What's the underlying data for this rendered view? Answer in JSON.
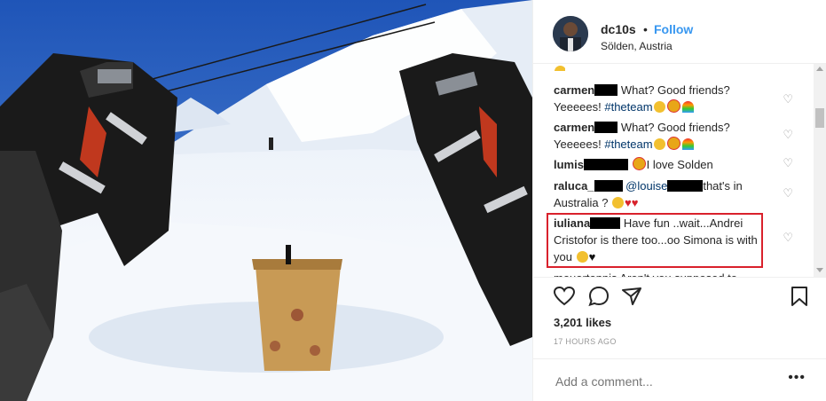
{
  "post": {
    "username": "dc10s",
    "separator": "•",
    "follow_label": "Follow",
    "location": "Sölden, Austria",
    "likes": "3,201 likes",
    "timestamp": "17 HOURS AGO",
    "add_comment_placeholder": "Add a comment...",
    "more_label": "•••"
  },
  "comments": [
    {
      "name": "carmen",
      "text_pre": "What? Good friends? Yeeeees! ",
      "tag": "#theteam"
    },
    {
      "name": "carmen",
      "text_pre": "What? Good friends? Yeeeees! ",
      "tag": "#theteam"
    },
    {
      "name": "lumis",
      "text": "I love Solden"
    },
    {
      "name": "raluca_",
      "mention": "@louise",
      "text": "that's in Australia ?"
    },
    {
      "name": "iuliana",
      "text": "Have fun ..wait...Andrei Cristofor is there too...oo Simona is with you"
    }
  ],
  "partial_comment": "mouortonnis Aren't you supposed to",
  "colors": {
    "accent": "#3897f0",
    "highlight": "#d9212c",
    "tag": "#003569"
  }
}
